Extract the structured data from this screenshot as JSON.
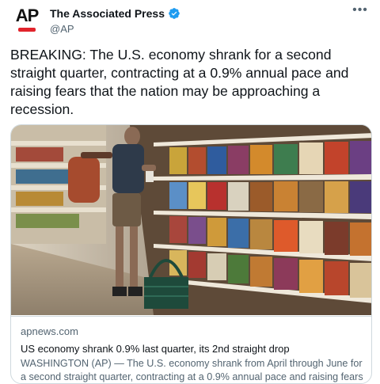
{
  "account": {
    "display_name": "The Associated Press",
    "handle": "@AP",
    "avatar_text": "AP",
    "verified": true
  },
  "more_menu": "•••",
  "tweet": {
    "text": "BREAKING: The U.S. economy shrank for a second straight quarter, contracting at a 0.9% annual pace and raising fears that the nation may be approaching a recession."
  },
  "card": {
    "domain": "apnews.com",
    "title": "US economy shrank 0.9% last quarter, its 2nd straight drop",
    "description": "WASHINGTON (AP) — The U.S. economy shrank from April through June for a second straight quarter, contracting at a 0.9% annual pace and raising fears th...",
    "image_alt": "shopper-in-grocery-cereal-aisle"
  },
  "colors": {
    "brand_red": "#e1242c",
    "verified_blue": "#1d9bf0",
    "secondary_text": "#536471",
    "border": "#cfd9de"
  }
}
